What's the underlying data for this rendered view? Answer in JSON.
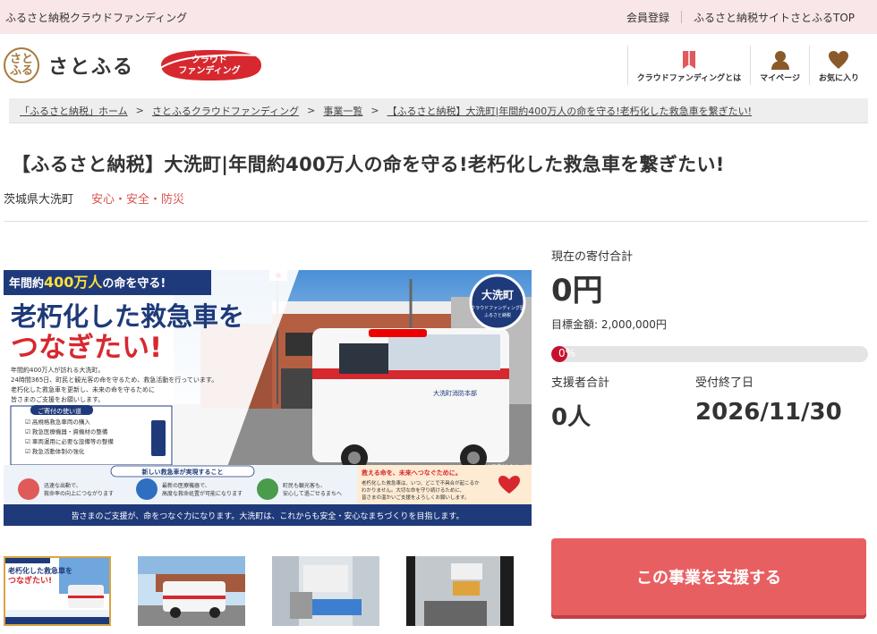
{
  "topbar": {
    "site_name": "ふるさと納税クラウドファンディング",
    "links": [
      "会員登録",
      "ふるさと納税サイトさとふるTOP"
    ]
  },
  "header": {
    "logo_mark": "さと\nふる",
    "logo_text": "さとふる",
    "cf_badge_line1": "クラウド",
    "cf_badge_line2": "ファンディング",
    "nav": [
      {
        "label": "クラウドファンディングとは",
        "icon": "bookmark-icon"
      },
      {
        "label": "マイページ",
        "icon": "person-icon"
      },
      {
        "label": "お気に入り",
        "icon": "heart-icon"
      }
    ]
  },
  "breadcrumb": [
    "「ふるさと納税」ホーム",
    "さとふるクラウドファンディング",
    "事業一覧",
    "【ふるさと納税】大洗町|年間約400万人の命を守る!老朽化した救急車を繋ぎたい!"
  ],
  "project": {
    "title": "【ふるさと納税】大洗町|年間約400万人の命を守る!老朽化した救急車を繋ぎたい!",
    "location": "茨城県大洗町",
    "category": "安心・安全・防災"
  },
  "banner": {
    "ribbon": "年間約400万人の命を守る!",
    "ribbon_highlight": "400万人",
    "headline1": "老朽化した救急車を",
    "headline2": "つなぎたい!",
    "body": [
      "年間約400万人が訪れる大洗町。",
      "24時間365日、町民と観光客の命を守るため、救急活動を行っています。",
      "老朽化した救急車を更新し、未来の命を守るために",
      "皆さまのご支援をお願いします。"
    ],
    "uses_title": "ご寄付の使い道",
    "uses": [
      "高規格救急車両の購入",
      "救急医療機器・資機材の整備",
      "車両運用に必要な設備等の整備",
      "救急活動体制の強化"
    ],
    "seal": [
      "大洗町",
      "クラウドファンディング型",
      "ふるさと納税"
    ],
    "new_title": "新しい救急車が実現すること",
    "features": [
      "迅速な出動で、救命率の向上につながります",
      "最新の医療機器で、高度な救命処置が可能になります",
      "町民も観光客も、安心して過ごせるまちへ"
    ],
    "future_title": "救える命を、未来へつなぐために。",
    "future_body": "老朽化した救急車は、いつ、どこで不具合が起こるかわかりません。大切な命を守り続けるために、皆さまの温かいご支援をよろしくお願いします。",
    "footer": "皆さまのご支援が、命をつなぐ力になります。大洗町は、これからも安全・安心なまちづくりを目指します。",
    "photo_note": "※画像はイメージです。",
    "ambulance_text": "大洗町消防本部"
  },
  "funding": {
    "total_label": "現在の寄付合計",
    "total_value": "0円",
    "goal_text": "目標金額: 2,000,000円",
    "progress": 0,
    "progress_text": "0%",
    "supporters_label": "支援者合計",
    "supporters_value": "0人",
    "deadline_label": "受付終了日",
    "deadline_value": "2026/11/30",
    "support_button": "この事業を支援する"
  },
  "colors": {
    "accent": "#e85f62",
    "category": "#d9534f",
    "progress": "#c8102e",
    "topbar": "#f8e6e8",
    "banner_navy": "#1f3a7a"
  }
}
